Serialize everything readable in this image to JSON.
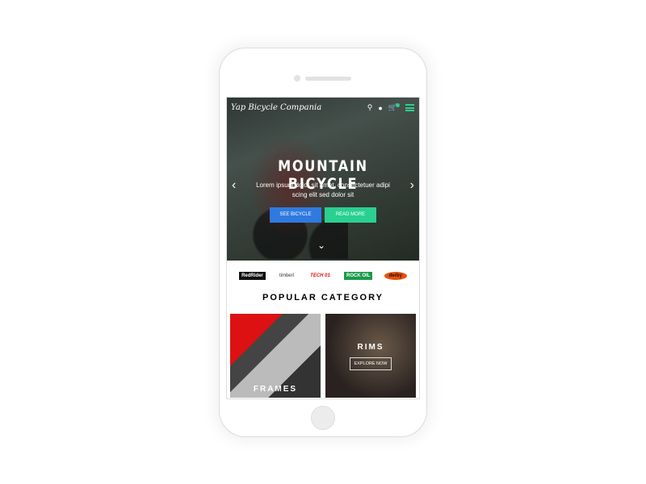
{
  "header": {
    "brand": "Yap Bicycle Compania",
    "cart_count": "0"
  },
  "hero": {
    "title": "MOUNTAIN BICYCLE",
    "subtitle": "Lorem ipsum dolor sit amet, consectetuer adipi scing elit sed dolor sit",
    "primary_button": "SEE BICYCLE",
    "secondary_button": "READ MORE",
    "prev": "‹",
    "next": "›",
    "down": "⌄"
  },
  "logos": [
    "RedRider",
    "timberl",
    "TECH 01",
    "ROCK OIL",
    "derby"
  ],
  "popular": {
    "heading": "POPULAR CATEGORY",
    "categories": [
      {
        "label": "FRAMES"
      },
      {
        "label": "RIMS",
        "cta": "EXPLORE NOW"
      }
    ]
  },
  "colors": {
    "accent": "#2ad08f",
    "primary": "#2f7ae0"
  }
}
